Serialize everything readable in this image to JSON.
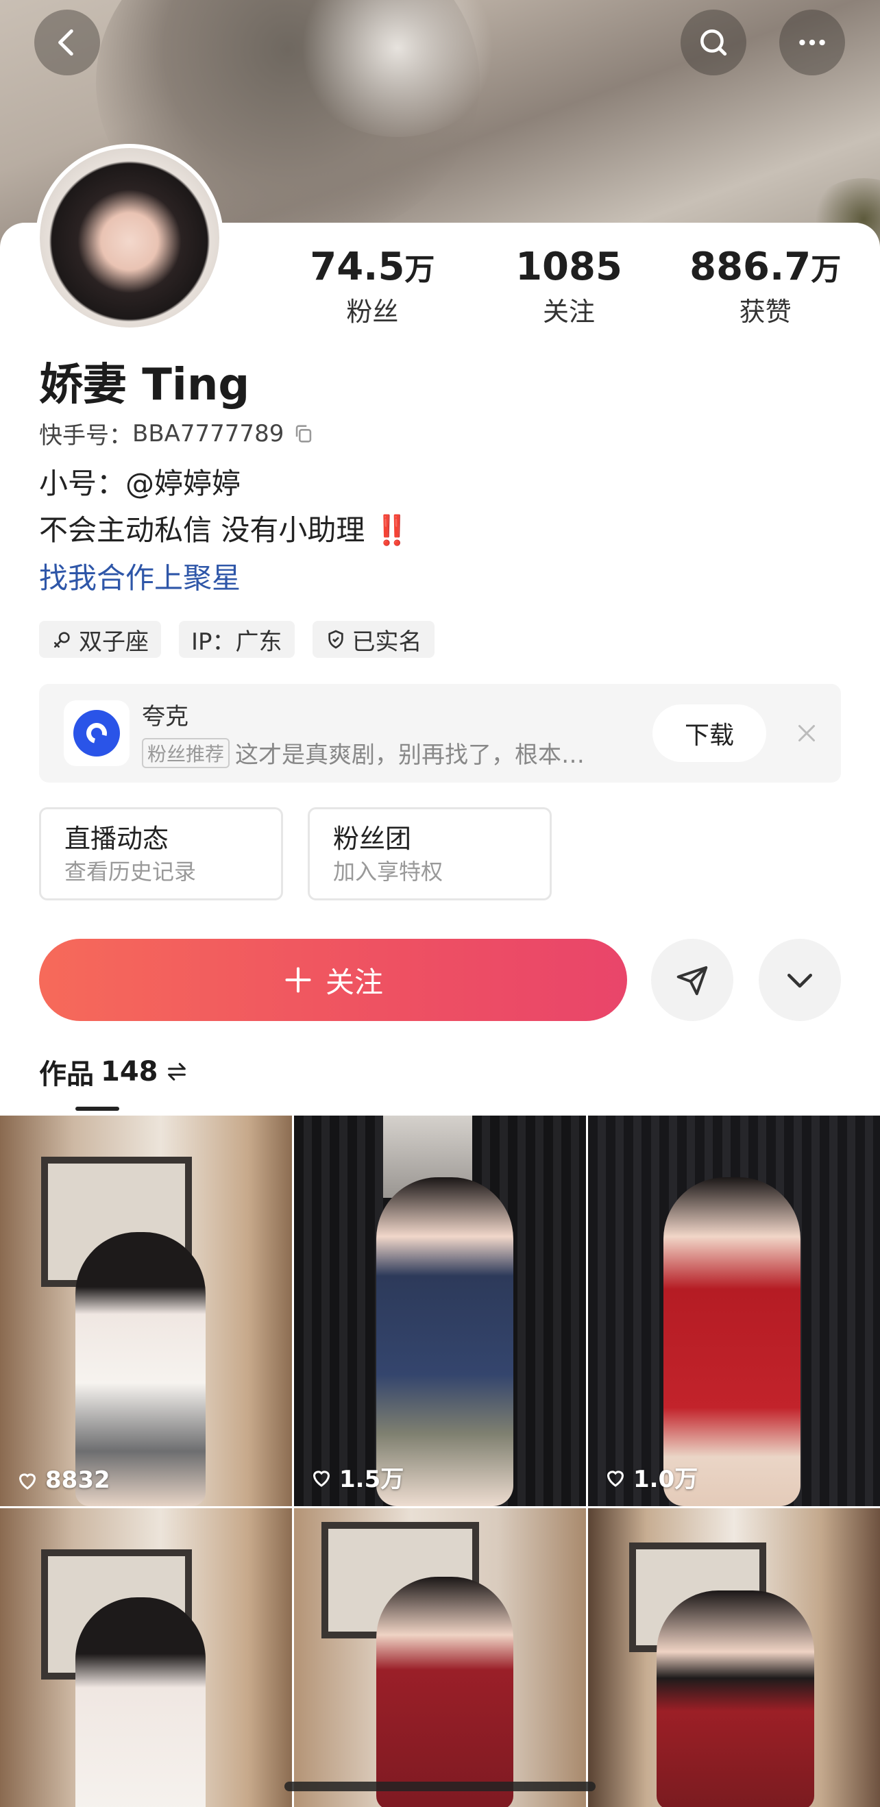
{
  "stats": [
    {
      "num": "74.5",
      "unit": "万",
      "label": "粉丝"
    },
    {
      "num": "1085",
      "unit": "",
      "label": "关注"
    },
    {
      "num": "886.7",
      "unit": "万",
      "label": "获赞"
    }
  ],
  "profile": {
    "name": "娇妻 Ting",
    "id_label": "快手号：",
    "id_value": "BBA7777789",
    "bio_line1": "小号：@婷婷婷",
    "bio_line2": "不会主动私信 没有小助理",
    "bio_emoji": "‼️",
    "collab_link": "找我合作上聚星"
  },
  "tags": [
    "双子座",
    "IP：广东",
    "已实名"
  ],
  "ad": {
    "app_name": "夸克",
    "badge": "粉丝推荐",
    "text": "这才是真爽剧，别再找了，根本…",
    "download": "下载"
  },
  "cards": [
    {
      "title": "直播动态",
      "subtitle": "查看历史记录"
    },
    {
      "title": "粉丝团",
      "subtitle": "加入享特权"
    }
  ],
  "follow_label": "关注",
  "works": {
    "label": "作品",
    "count": "148"
  },
  "videos": [
    {
      "likes": "8832"
    },
    {
      "likes": "1.5万"
    },
    {
      "likes": "1.0万"
    },
    {
      "likes": ""
    },
    {
      "likes": ""
    },
    {
      "likes": ""
    }
  ]
}
